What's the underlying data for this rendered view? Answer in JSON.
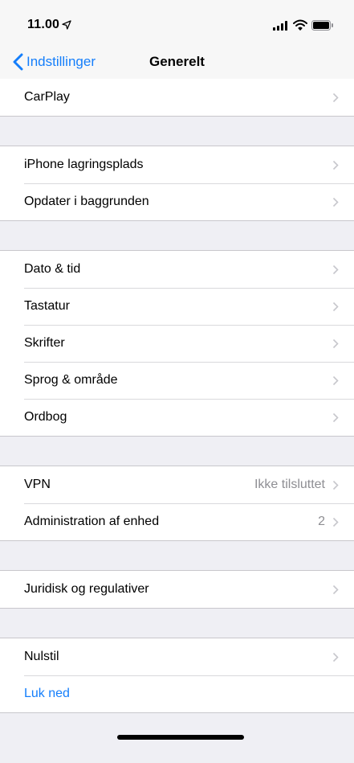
{
  "status_bar": {
    "time": "11.00",
    "icons": [
      "location-arrow-icon",
      "cellular-signal-icon",
      "wifi-icon",
      "battery-icon"
    ]
  },
  "nav": {
    "back_label": "Indstillinger",
    "title": "Generelt"
  },
  "groups": [
    {
      "rows": [
        {
          "label": "CarPlay",
          "value": ""
        }
      ]
    },
    {
      "rows": [
        {
          "label": "iPhone lagringsplads",
          "value": ""
        },
        {
          "label": "Opdater i baggrunden",
          "value": ""
        }
      ]
    },
    {
      "rows": [
        {
          "label": "Dato & tid",
          "value": ""
        },
        {
          "label": "Tastatur",
          "value": ""
        },
        {
          "label": "Skrifter",
          "value": ""
        },
        {
          "label": "Sprog & område",
          "value": ""
        },
        {
          "label": "Ordbog",
          "value": ""
        }
      ]
    },
    {
      "rows": [
        {
          "label": "VPN",
          "value": "Ikke tilsluttet"
        },
        {
          "label": "Administration af enhed",
          "value": "2"
        }
      ]
    },
    {
      "rows": [
        {
          "label": "Juridisk og regulativer",
          "value": ""
        }
      ]
    },
    {
      "rows": [
        {
          "label": "Nulstil",
          "value": ""
        },
        {
          "label": "Luk ned",
          "value": "",
          "link": true
        }
      ]
    }
  ],
  "colors": {
    "accent": "#147efb",
    "background": "#efeff4",
    "secondary_text": "#8e8e93"
  }
}
